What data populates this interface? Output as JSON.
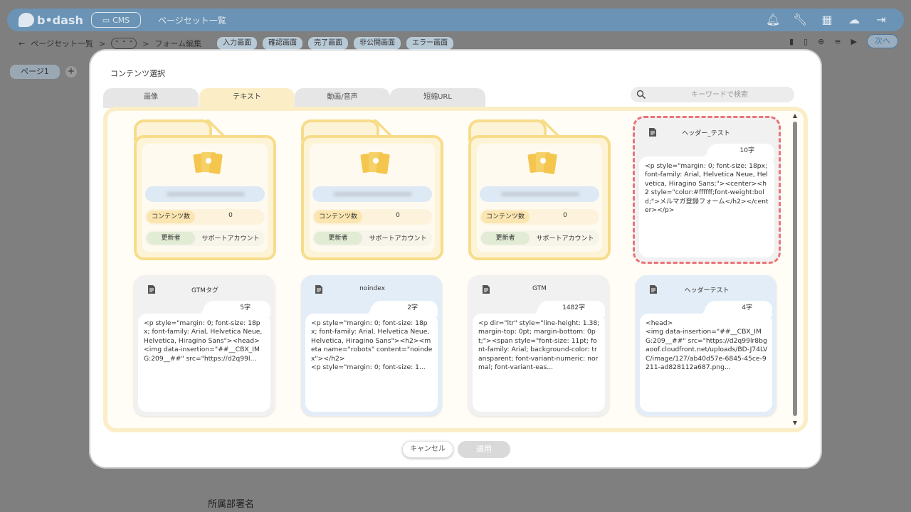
{
  "app": {
    "logo_text": "b•dash",
    "cms_label": "CMS",
    "page_title": "ページセット一覧"
  },
  "breadcrumb": {
    "root": "ページセット一覧",
    "ellipsis": "・・・",
    "current": "フォーム編集"
  },
  "steps": [
    "入力画面",
    "確認画面",
    "完了画面",
    "非公開画面",
    "エラー画面"
  ],
  "next_label": "次へ",
  "page_tab": "ページ1",
  "page_add": "+",
  "bottom_label": "所属部署名",
  "modal": {
    "title": "コンテンツ選択",
    "tabs": [
      "画像",
      "テキスト",
      "動画/音声",
      "短縮URL"
    ],
    "active_tab": "テキスト",
    "search_placeholder": "キーワードで検索",
    "folders": [
      {
        "count_label": "コンテンツ数",
        "count": "0",
        "updater_label": "更新者",
        "updater": "サポートアカウント"
      },
      {
        "count_label": "コンテンツ数",
        "count": "0",
        "updater_label": "更新者",
        "updater": "サポートアカウント"
      },
      {
        "count_label": "コンテンツ数",
        "count": "0",
        "updater_label": "更新者",
        "updater": "サポートアカウント"
      }
    ],
    "cards": [
      {
        "title": "ヘッダー_テスト",
        "count": "10字",
        "color": "gray",
        "selected": true,
        "body": "<p style=\"margin: 0; font-size: 18px; font-family: Arial, Helvetica Neue, Helvetica, Hiragino Sans;\"><center><h2 style=\"color:#ffffff;font-weight:bold;\">メルマガ登録フォーム</h2></center></p>"
      },
      {
        "title": "GTMタグ",
        "count": "5字",
        "color": "gray",
        "selected": false,
        "body": "<p style=\"margin: 0; font-size: 18px; font-family: Arial, Helvetica Neue, Helvetica, Hiragino Sans\"><head>\n<img data-insertion=\"##__CBX_IMG:209__##\" src=\"https://d2q99l..."
      },
      {
        "title": "noindex",
        "count": "2字",
        "color": "blue",
        "selected": false,
        "body": "<p style=\"margin: 0; font-size: 18px; font-family: Arial, Helvetica Neue, Helvetica, Hiragino Sans\"><h2><meta name=\"robots\" content=\"noindex\"></h2>\n<p style=\"margin: 0; font-size: 1..."
      },
      {
        "title": "GTM",
        "count": "1482字",
        "color": "gray",
        "selected": false,
        "body": "<p dir=\"ltr\" style=\"line-height: 1.38; margin-top: 0pt; margin-bottom: 0pt;\"><span style=\"font-size: 11pt; font-family: Arial; background-color: transparent; font-variant-numeric: normal; font-variant-eas..."
      },
      {
        "title": "ヘッダーテスト",
        "count": "4字",
        "color": "blue",
        "selected": false,
        "body": "<head>\n<img data-insertion=\"##__CBX_IMG:209__##\" src=\"https://d2q99lr8bgaoof.cloudfront.net/uploads/BD-J74LVC/image/127/ab40d57e-6845-45ce-9211-ad828112a687.png..."
      }
    ],
    "cancel_label": "キャンセル",
    "apply_label": "適用"
  },
  "colors": {
    "accent_yellow": "#f7dc8a",
    "selected_border": "#ec7277",
    "header_blue": "#6a93b5"
  }
}
